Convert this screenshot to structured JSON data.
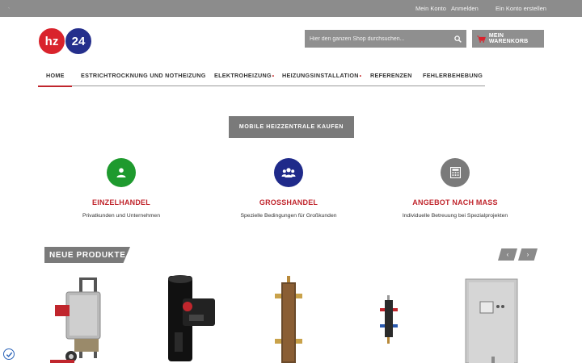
{
  "topbar": {
    "tick": "ˎ",
    "links": [
      "Mein Konto",
      "Anmelden",
      "Ein Konto erstellen"
    ]
  },
  "logo": {
    "left": "hz",
    "right": "24",
    "colors": {
      "left": "#d9232c",
      "right": "#252f8c"
    }
  },
  "search": {
    "placeholder": "Hier den ganzen Shop durchsuchen...",
    "icon": "search-icon"
  },
  "cart": {
    "label": "MEIN WARENKORB",
    "icon": "cart-icon"
  },
  "nav": {
    "items": [
      {
        "label": "HOME",
        "active": true
      },
      {
        "label": "ESTRICHTROCKNUNG UND NOTHEIZUNG"
      },
      {
        "label": "ELEKTROHEIZUNG",
        "has_submenu": true
      },
      {
        "label": "HEIZUNGSINSTALLATION",
        "has_submenu": true
      },
      {
        "label": "REFERENZEN"
      },
      {
        "label": "FEHLERBEHEBUNG"
      }
    ]
  },
  "cta": {
    "label": "MOBILE HEIZZENTRALE KAUFEN"
  },
  "features": [
    {
      "title": "EINZELHANDEL",
      "subtitle": "Privatkunden und Unternehmen",
      "icon": "user-icon",
      "color": "#1e9a2e"
    },
    {
      "title": "GROSSHANDEL",
      "subtitle": "Spezielle Bedingungen für Großkunden",
      "icon": "users-icon",
      "color": "#1f2a8a"
    },
    {
      "title": "ANGEBOT NACH MASS",
      "subtitle": "Individuelle Betreuung bei Spezialprojekten",
      "icon": "calculator-icon",
      "color": "#7a7a7a"
    }
  ],
  "products": {
    "heading": "NEUE PRODUKTE",
    "prev": "‹",
    "next": "›"
  },
  "colors": {
    "accent": "#c0262d",
    "bar": "#8c8c8c"
  }
}
